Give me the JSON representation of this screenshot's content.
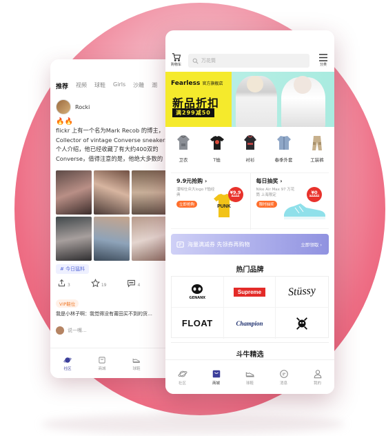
{
  "community_screen": {
    "tabs": [
      "推荐",
      "视频",
      "球鞋",
      "Girls",
      "沙雕",
      "潮"
    ],
    "post": {
      "username": "Rocki",
      "emoji": "🔥🔥",
      "lines": [
        "flickr 上有一个名为Mark Recob 的博主，",
        "Collector of vintage Converse sneakers",
        "个人介绍，他已经收藏了有大约400双的",
        "Converse，值得注意的是，他绝大多数的"
      ],
      "topic_tag": "# 今日猛料",
      "likes": "3",
      "stars": "19",
      "comments": "4"
    },
    "vip_badge": "VIP鞋位",
    "comment": "我是小林子啊：我觉得没有莆田买不到的货…",
    "comment_placeholder": "说一嘴...",
    "nav": [
      {
        "label": "社区",
        "icon": "planet-icon"
      },
      {
        "label": "商城",
        "icon": "shop-icon"
      },
      {
        "label": "球鞋",
        "icon": "sneaker-icon"
      },
      {
        "label": "消息",
        "icon": "message-icon"
      }
    ]
  },
  "mall_screen": {
    "header": {
      "cart_label": "购物车",
      "search_placeholder": "万花筒",
      "menu_label": "分类"
    },
    "banner": {
      "brand": "Fearless",
      "brand_cn": "官方旗舰店",
      "title": "新品折扣",
      "subtitle": "满299减50"
    },
    "categories": [
      {
        "label": "卫衣",
        "icon": "hoodie-icon"
      },
      {
        "label": "T恤",
        "icon": "tshirt-icon"
      },
      {
        "label": "衬衫",
        "icon": "shirt-icon"
      },
      {
        "label": "春季外套",
        "icon": "jacket-icon"
      },
      {
        "label": "工装裤",
        "icon": "pants-icon"
      }
    ],
    "promos": [
      {
        "title": "9.9元抢购",
        "subtitle": "潘帕仕众大logo T恤经典",
        "button": "立即抢购",
        "price": "¥9.9",
        "old_price": "¥168"
      },
      {
        "title": "每日抽奖",
        "subtitle": "Nike Air Max 97 万花筒 上海限定",
        "button": "限时抽奖",
        "price": "¥0",
        "old_price": "¥4999"
      }
    ],
    "coupon": {
      "text": "海量满减券 先领券再购物",
      "action": "立即领取"
    },
    "brands_title": "热门品牌",
    "brands": [
      "GENANX",
      "Supreme",
      "Stüssy",
      "FLOAT",
      "Champion",
      "SKULL"
    ],
    "section_next": "斗牛精选",
    "nav": [
      {
        "label": "社区",
        "icon": "planet-icon"
      },
      {
        "label": "商城",
        "icon": "shop-icon"
      },
      {
        "label": "球鞋",
        "icon": "sneaker-icon"
      },
      {
        "label": "消息",
        "icon": "message-icon"
      },
      {
        "label": "我的",
        "icon": "user-icon"
      }
    ],
    "active_nav": "商城"
  },
  "colors": {
    "accent": "#e4485f",
    "banner_yellow": "#f5ea2c",
    "price_red": "#e8322c",
    "coupon_purple": "#9092e0"
  }
}
